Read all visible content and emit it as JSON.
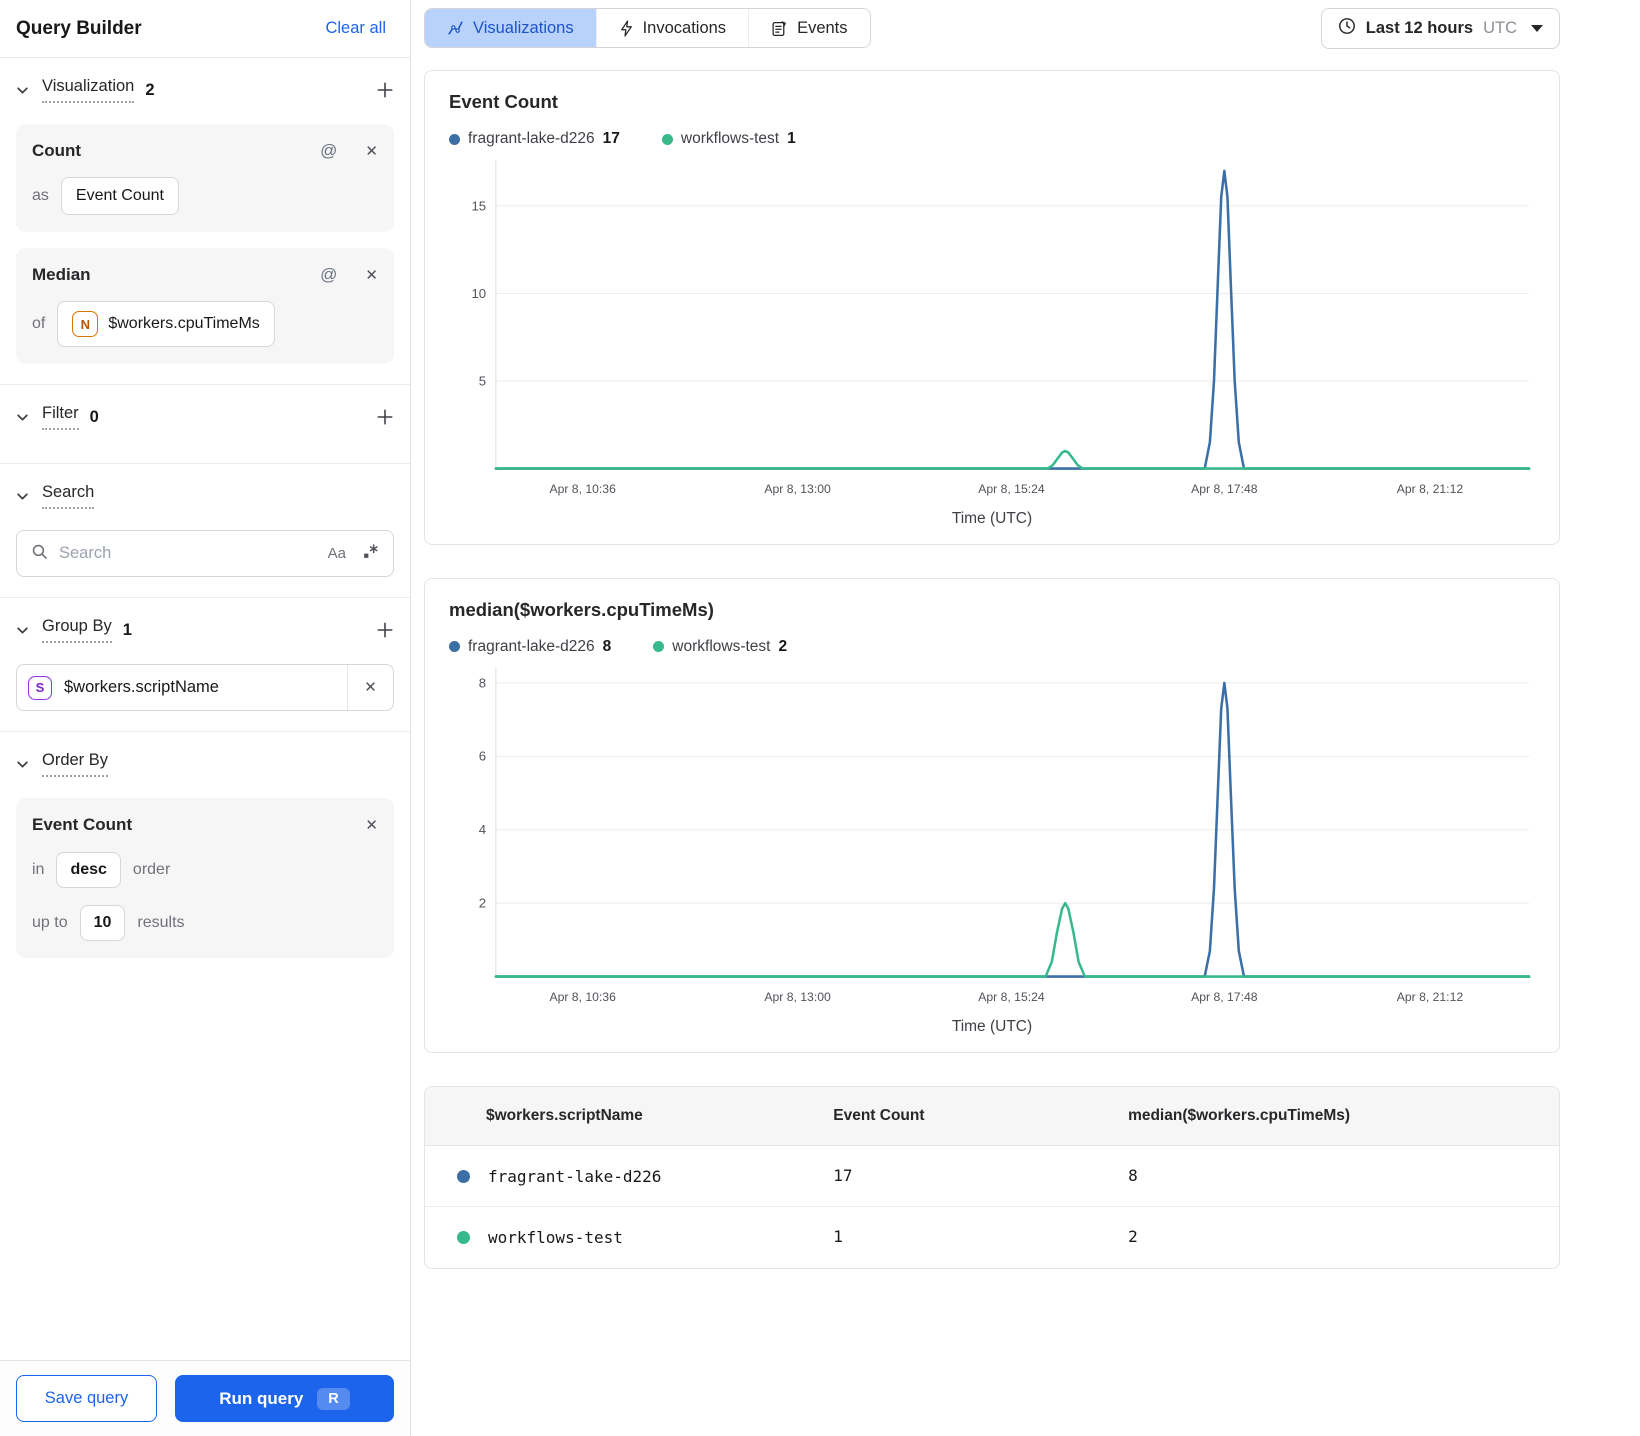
{
  "sidebar": {
    "title": "Query Builder",
    "clear_all_label": "Clear all",
    "icons": {
      "at": "@",
      "case_toggle": "Aa"
    },
    "visualization": {
      "label": "Visualization",
      "count": "2"
    },
    "visualization_cards": [
      {
        "title": "Count",
        "prefix_label": "as",
        "value": "Event Count"
      },
      {
        "title": "Median",
        "prefix_label": "of",
        "badge_letter": "N",
        "value": "$workers.cpuTimeMs"
      }
    ],
    "filter": {
      "label": "Filter",
      "count": "0"
    },
    "search": {
      "label": "Search",
      "placeholder": "Search"
    },
    "group_by": {
      "label": "Group By",
      "count": "1"
    },
    "group_by_items": [
      {
        "badge_letter": "S",
        "value": "$workers.scriptName"
      }
    ],
    "order_by": {
      "label": "Order By",
      "field": "Event Count",
      "in_label": "in",
      "direction": "desc",
      "order_label": "order",
      "up_to_label": "up to",
      "limit": "10",
      "results_label": "results"
    },
    "footer": {
      "save_label": "Save query",
      "run_label": "Run query",
      "run_shortcut": "R"
    }
  },
  "toolbar": {
    "tabs": [
      {
        "label": "Visualizations",
        "active": true
      },
      {
        "label": "Invocations",
        "active": false
      },
      {
        "label": "Events",
        "active": false
      }
    ],
    "time_picker": {
      "range_label": "Last 12 hours",
      "timezone_label": "UTC"
    }
  },
  "chart_data": [
    {
      "type": "line",
      "title": "Event Count",
      "xlabel": "Time (UTC)",
      "ylim": [
        0,
        17.4
      ],
      "yticks": [
        5,
        10,
        15
      ],
      "grid": true,
      "legend_position": "top",
      "x_tick_labels": [
        "Apr 8, 10:36",
        "Apr 8, 13:00",
        "Apr 8, 15:24",
        "Apr 8, 17:48",
        "Apr 8, 21:12"
      ],
      "x_tick_fractions": [
        0.084,
        0.292,
        0.499,
        0.705,
        0.904
      ],
      "series": [
        {
          "name": "fragrant-lake-d226",
          "total": "17",
          "color": "#3b6fa5",
          "peak_time": "Apr 8, ~17:48",
          "peak_value": 17,
          "points": [
            [
              0,
              0
            ],
            [
              0.686,
              0
            ],
            [
              0.691,
              1.5
            ],
            [
              0.695,
              5
            ],
            [
              0.699,
              11
            ],
            [
              0.702,
              15.5
            ],
            [
              0.705,
              17
            ],
            [
              0.708,
              15.5
            ],
            [
              0.711,
              11
            ],
            [
              0.715,
              5
            ],
            [
              0.719,
              1.5
            ],
            [
              0.724,
              0
            ],
            [
              1,
              0
            ]
          ]
        },
        {
          "name": "workflows-test",
          "total": "1",
          "color": "#38b98c",
          "peak_time": "Apr 8, ~15:45",
          "peak_value": 1,
          "points": [
            [
              0,
              0
            ],
            [
              0.534,
              0
            ],
            [
              0.539,
              0.2
            ],
            [
              0.544,
              0.6
            ],
            [
              0.548,
              0.92
            ],
            [
              0.551,
              1
            ],
            [
              0.554,
              0.92
            ],
            [
              0.558,
              0.6
            ],
            [
              0.563,
              0.2
            ],
            [
              0.568,
              0
            ],
            [
              1,
              0
            ]
          ]
        }
      ]
    },
    {
      "type": "line",
      "title": "median($workers.cpuTimeMs)",
      "xlabel": "Time (UTC)",
      "ylim": [
        0,
        8.3
      ],
      "yticks": [
        2,
        4,
        6,
        8
      ],
      "grid": true,
      "legend_position": "top",
      "x_tick_labels": [
        "Apr 8, 10:36",
        "Apr 8, 13:00",
        "Apr 8, 15:24",
        "Apr 8, 17:48",
        "Apr 8, 21:12"
      ],
      "x_tick_fractions": [
        0.084,
        0.292,
        0.499,
        0.705,
        0.904
      ],
      "series": [
        {
          "name": "fragrant-lake-d226",
          "total": "8",
          "color": "#3b6fa5",
          "peak_time": "Apr 8, ~17:48",
          "peak_value": 8,
          "points": [
            [
              0,
              0
            ],
            [
              0.686,
              0
            ],
            [
              0.691,
              0.7
            ],
            [
              0.695,
              2.4
            ],
            [
              0.699,
              5.2
            ],
            [
              0.702,
              7.3
            ],
            [
              0.705,
              8
            ],
            [
              0.708,
              7.3
            ],
            [
              0.711,
              5.2
            ],
            [
              0.715,
              2.4
            ],
            [
              0.719,
              0.7
            ],
            [
              0.724,
              0
            ],
            [
              1,
              0
            ]
          ]
        },
        {
          "name": "workflows-test",
          "total": "2",
          "color": "#38b98c",
          "peak_time": "Apr 8, ~15:45",
          "peak_value": 2,
          "points": [
            [
              0,
              0
            ],
            [
              0.532,
              0
            ],
            [
              0.538,
              0.4
            ],
            [
              0.543,
              1.2
            ],
            [
              0.548,
              1.85
            ],
            [
              0.551,
              2
            ],
            [
              0.554,
              1.85
            ],
            [
              0.559,
              1.2
            ],
            [
              0.564,
              0.4
            ],
            [
              0.57,
              0
            ],
            [
              1,
              0
            ]
          ]
        }
      ]
    }
  ],
  "results_table": {
    "headers": [
      "$workers.scriptName",
      "Event Count",
      "median($workers.cpuTimeMs)"
    ],
    "rows": [
      {
        "color": "#3b6fa5",
        "script_name": "fragrant-lake-d226",
        "event_count": "17",
        "median": "8"
      },
      {
        "color": "#38b98c",
        "script_name": "workflows-test",
        "event_count": "1",
        "median": "2"
      }
    ]
  },
  "colors": {
    "accent_blue": "#1c64ec",
    "active_tab_bg": "#b9d2fb",
    "series_blue": "#3b6fa5",
    "series_green": "#38b98c"
  }
}
